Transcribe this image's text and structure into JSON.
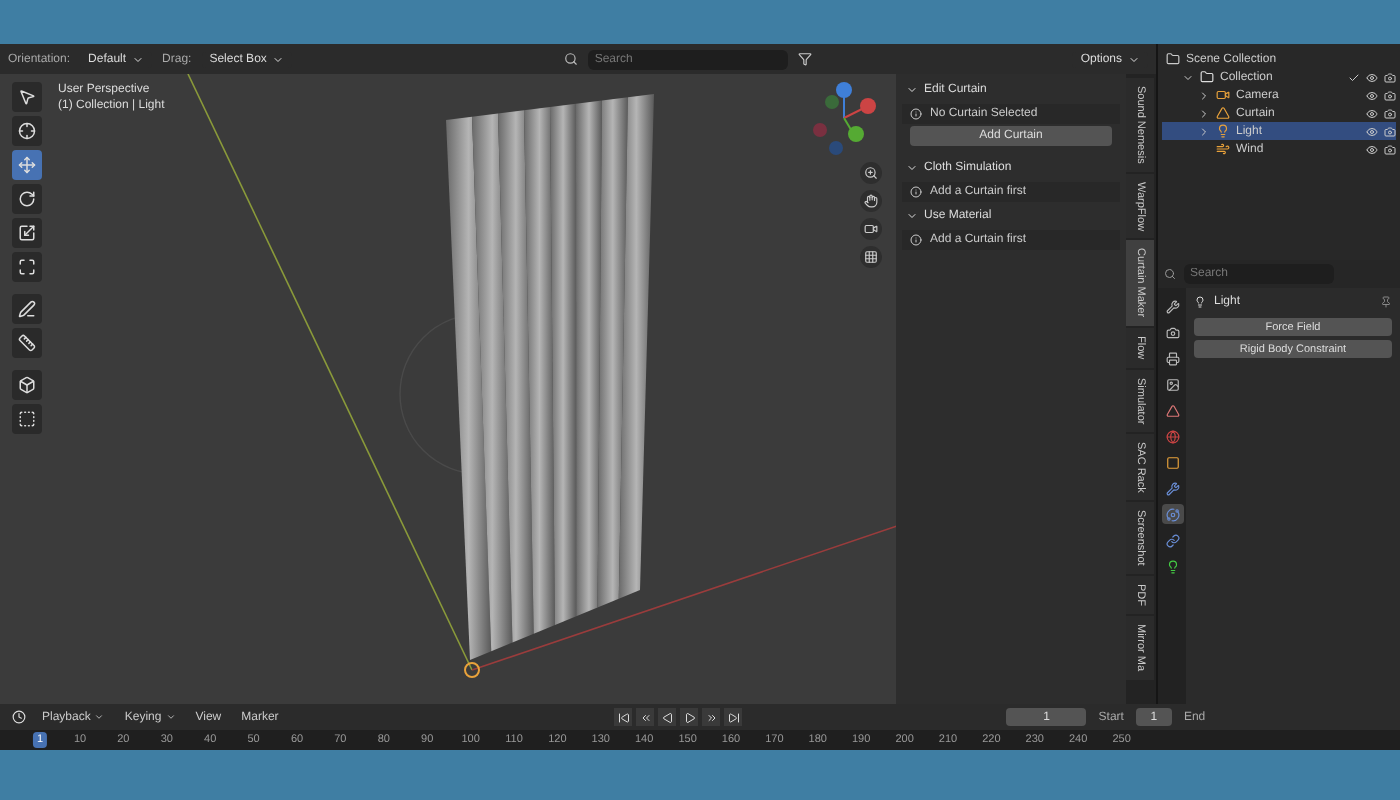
{
  "header": {
    "orientation_label": "Orientation:",
    "orientation": "Default",
    "drag_label": "Drag:",
    "drag": "Select Box",
    "search": {
      "placeholder": "Search"
    },
    "options": "Options"
  },
  "viewport": {
    "title": "User Perspective",
    "context": "(1) Collection | Light"
  },
  "tools": [
    {
      "kind": "select",
      "selected": false
    },
    {
      "kind": "cursor",
      "selected": false
    },
    {
      "kind": "move",
      "selected": true
    },
    {
      "kind": "rotate",
      "selected": false
    },
    {
      "kind": "scale",
      "selected": false
    },
    {
      "kind": "transform",
      "selected": false
    },
    {
      "kind": "annotate",
      "selected": false
    },
    {
      "kind": "measure",
      "selected": false
    },
    {
      "kind": "add",
      "selected": false
    },
    {
      "kind": "extrude",
      "selected": false
    }
  ],
  "sidebar_panel": {
    "sections": [
      {
        "title": "Edit Curtain",
        "expanded": true,
        "message": "No Curtain Selected",
        "button": "Add Curtain"
      },
      {
        "title": "Cloth Simulation",
        "expanded": true,
        "message": "Add a Curtain first"
      },
      {
        "title": "Use Material",
        "expanded": true,
        "message": "Add a Curtain first"
      }
    ]
  },
  "sidebar_tabs": [
    {
      "label": "Sound Nemesis",
      "selected": false
    },
    {
      "label": "WarpFlow",
      "selected": false
    },
    {
      "label": "Curtain Maker",
      "selected": true
    },
    {
      "label": "Flow",
      "selected": false
    },
    {
      "label": "Simulator",
      "selected": false
    },
    {
      "label": "SAC Rack",
      "selected": false
    },
    {
      "label": "Screenshot",
      "selected": false
    },
    {
      "label": "PDF",
      "selected": false
    },
    {
      "label": "Mirror Ma",
      "selected": false
    }
  ],
  "outliner": {
    "title": "Scene Collection",
    "items": [
      {
        "label": "Collection",
        "kind": "collection",
        "selected": false,
        "expanded": true,
        "children": [
          {
            "label": "Camera",
            "kind": "camera",
            "selected": false,
            "expanded": false
          },
          {
            "label": "Curtain",
            "kind": "mesh",
            "selected": false,
            "expanded": false
          },
          {
            "label": "Light",
            "kind": "light",
            "selected": true,
            "expanded": false
          },
          {
            "label": "Wind",
            "kind": "force",
            "selected": false
          }
        ]
      }
    ]
  },
  "properties": {
    "search": {
      "placeholder": "Search"
    },
    "object": "Light",
    "buttons": [
      "Force Field",
      "Rigid Body Constraint"
    ],
    "tabs": [
      {
        "kind": "tool",
        "selected": false
      },
      {
        "kind": "render",
        "selected": false
      },
      {
        "kind": "output",
        "selected": false
      },
      {
        "kind": "view_layer",
        "selected": false
      },
      {
        "kind": "scene",
        "selected": false
      },
      {
        "kind": "world",
        "selected": false
      },
      {
        "kind": "object",
        "selected": false
      },
      {
        "kind": "modifiers",
        "selected": false
      },
      {
        "kind": "physics",
        "selected": true
      },
      {
        "kind": "constraints",
        "selected": false
      },
      {
        "kind": "data",
        "selected": false
      }
    ]
  },
  "timeline": {
    "menus": [
      "Playback",
      "Keying",
      "View",
      "Marker"
    ],
    "frame": "1",
    "start_label": "Start",
    "start": "1",
    "end_label": "End",
    "ruler": [
      "1",
      "10",
      "20",
      "30",
      "40",
      "50",
      "60",
      "70",
      "80",
      "90",
      "100",
      "110",
      "120",
      "130",
      "140",
      "150",
      "160",
      "170",
      "180",
      "190",
      "200",
      "210",
      "220",
      "230",
      "240",
      "250"
    ]
  }
}
